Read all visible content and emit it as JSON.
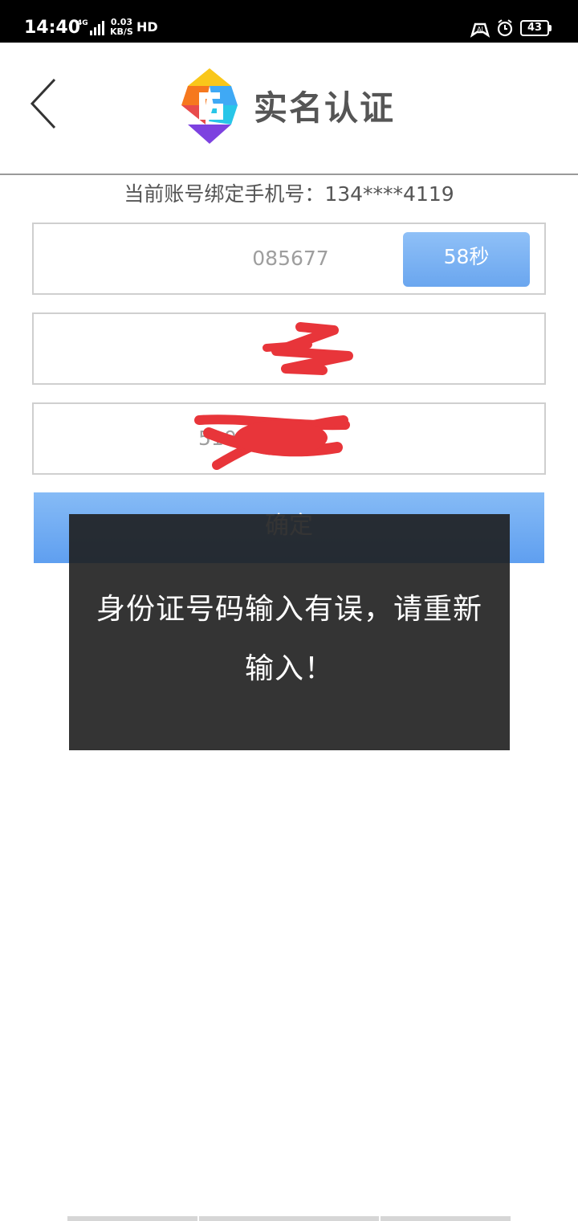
{
  "status_bar": {
    "time": "14:40",
    "network": "4G",
    "speed_value": "0.03",
    "speed_unit": "KB/S",
    "hd": "HD",
    "battery": "43"
  },
  "header": {
    "title": "实名认证",
    "icons": {
      "back": "chevron-left-icon",
      "logo": "app-logo"
    }
  },
  "bound_phone": "当前账号绑定手机号：134****4119",
  "form": {
    "code_value": "085677",
    "countdown_label": "58秒",
    "name_value": "",
    "id_value": "5103  5433x",
    "confirm_label": "确定"
  },
  "toast": {
    "message": "身份证号码输入有误，请重新输入！"
  },
  "colors": {
    "accent": "#6aa6ef",
    "redaction": "#e8353a",
    "toast_bg": "#1e1e1e"
  }
}
